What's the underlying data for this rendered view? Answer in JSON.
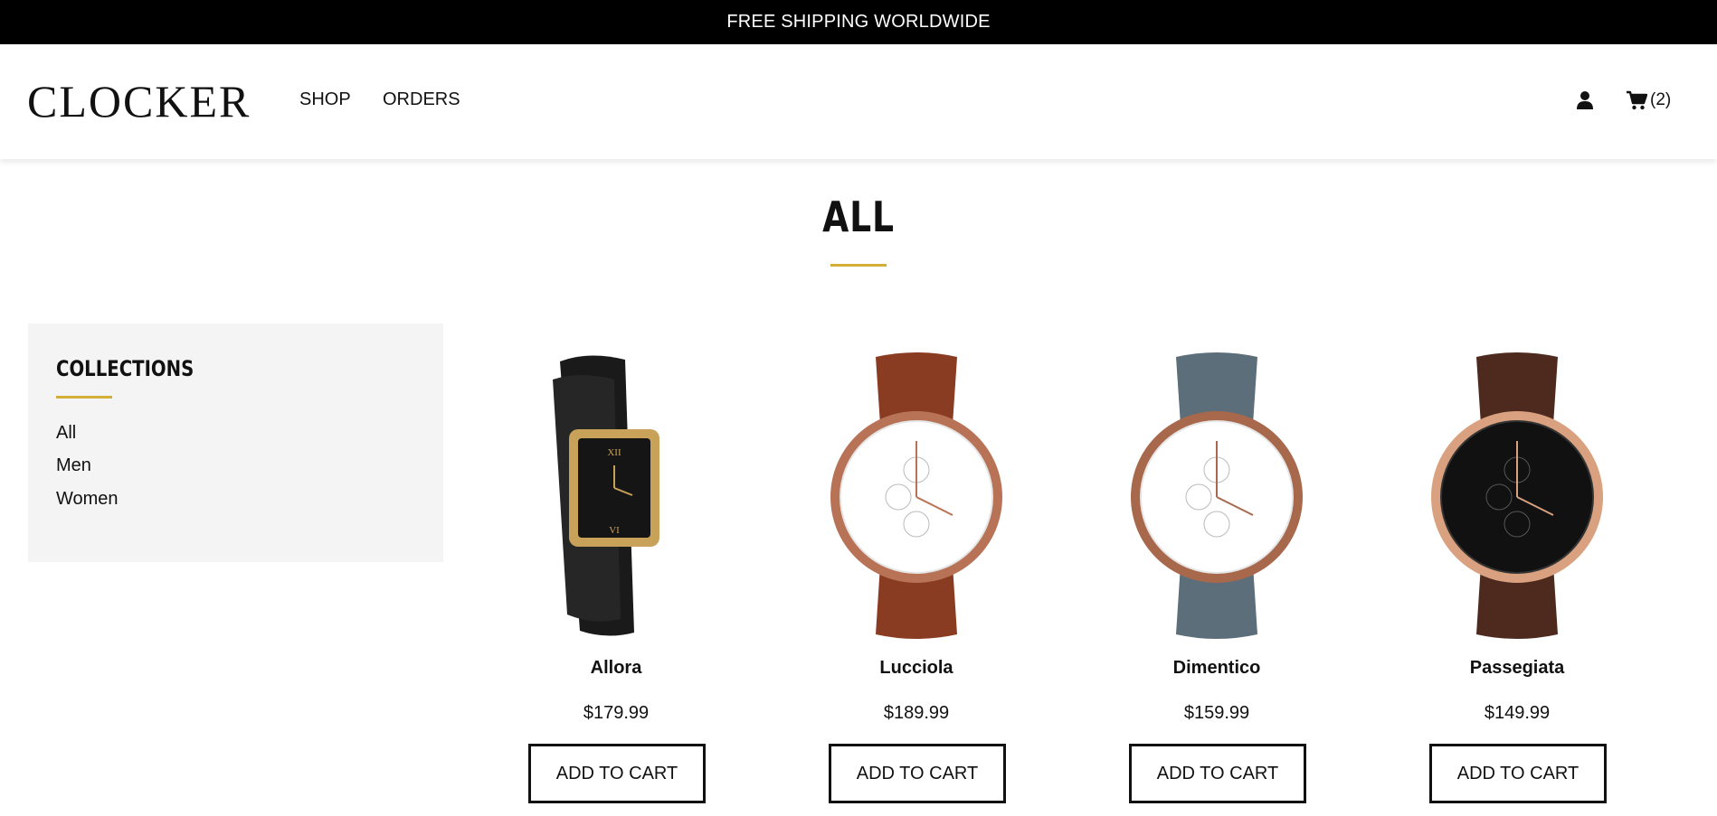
{
  "topbar": {
    "text": "FREE SHIPPING WORLDWIDE"
  },
  "header": {
    "logo": "CLOCKER",
    "nav": [
      {
        "label": "SHOP"
      },
      {
        "label": "ORDERS"
      }
    ],
    "user_icon": "user-icon",
    "cart_icon": "shopping-cart-icon",
    "cart_count": "(2)"
  },
  "page": {
    "title": "ALL",
    "accent_color": "#d4af37"
  },
  "sidebar": {
    "title": "COLLECTIONS",
    "items": [
      {
        "label": "All"
      },
      {
        "label": "Men"
      },
      {
        "label": "Women"
      }
    ]
  },
  "products": [
    {
      "name": "Allora",
      "price": "$179.99",
      "button": "ADD TO CART",
      "strap_color": "#1a1a1a",
      "case_color": "#c9a25a",
      "dial_color": "#151515"
    },
    {
      "name": "Lucciola",
      "price": "$189.99",
      "button": "ADD TO CART",
      "strap_color": "#8a3c22",
      "case_color": "#b87357",
      "dial_color": "#ffffff"
    },
    {
      "name": "Dimentico",
      "price": "$159.99",
      "button": "ADD TO CART",
      "strap_color": "#5c6e7a",
      "case_color": "#a8684c",
      "dial_color": "#ffffff"
    },
    {
      "name": "Passegiata",
      "price": "$149.99",
      "button": "ADD TO CART",
      "strap_color": "#4e2a1e",
      "case_color": "#d9a17f",
      "dial_color": "#111111"
    }
  ]
}
